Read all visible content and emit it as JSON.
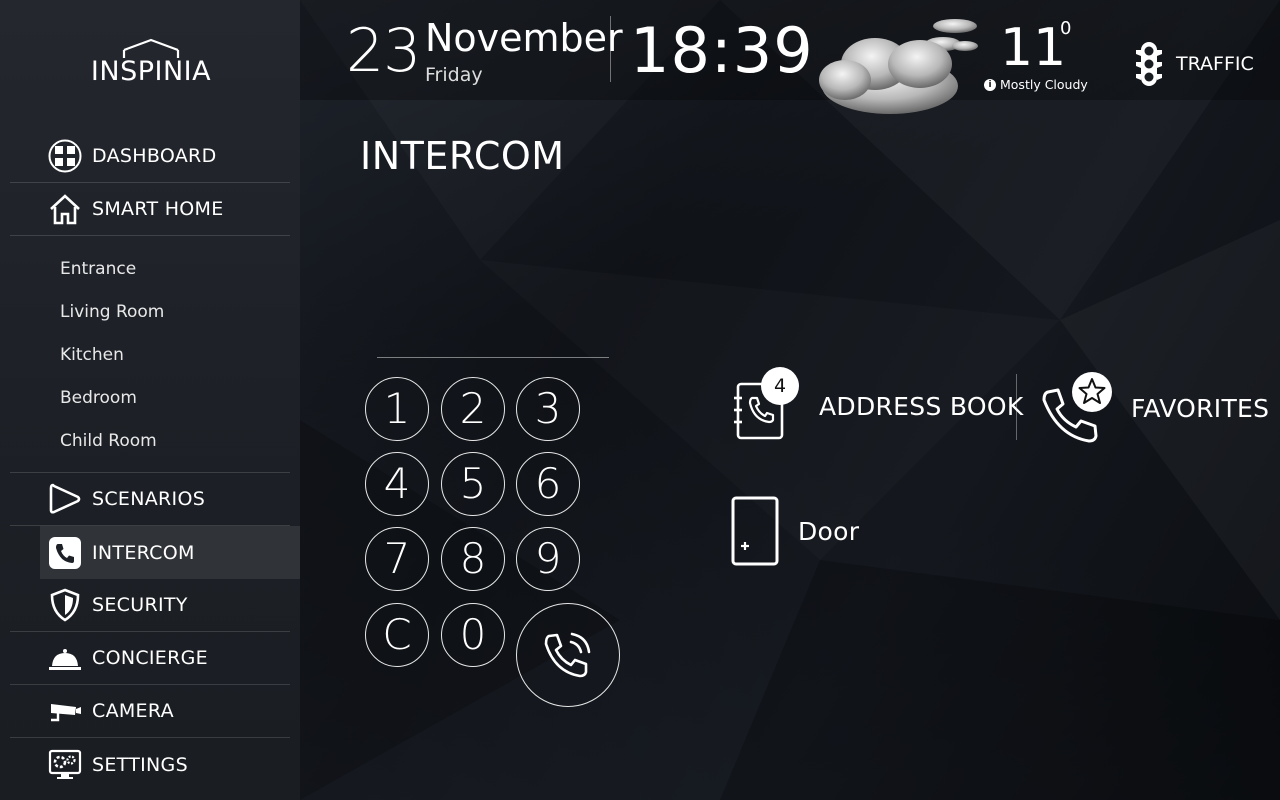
{
  "brand": {
    "logo_text": "INSPINIA"
  },
  "sidebar": {
    "items": [
      {
        "label": "DASHBOARD",
        "icon": "dashboard-icon"
      },
      {
        "label": "SMART HOME",
        "icon": "home-icon"
      },
      {
        "label": "SCENARIOS",
        "icon": "scenarios-icon"
      },
      {
        "label": "INTERCOM",
        "icon": "phone-icon",
        "active": true
      },
      {
        "label": "SECURITY",
        "icon": "shield-icon"
      },
      {
        "label": "CONCIERGE",
        "icon": "service-bell-icon"
      },
      {
        "label": "CAMERA",
        "icon": "camera-icon"
      },
      {
        "label": "SETTINGS",
        "icon": "settings-icon"
      }
    ],
    "rooms": [
      "Entrance",
      "Living Room",
      "Kitchen",
      "Bedroom",
      "Child Room"
    ]
  },
  "header": {
    "day": "23",
    "month": "November",
    "weekday": "Friday",
    "time": "18:39",
    "weather": {
      "temperature": "11",
      "unit": "0",
      "condition": "Mostly Cloudy",
      "icon": "cloud-icon"
    },
    "traffic_label": "TRAFFIC"
  },
  "main": {
    "title": "INTERCOM",
    "dial_value": "",
    "keypad": [
      "1",
      "2",
      "3",
      "4",
      "5",
      "6",
      "7",
      "8",
      "9",
      "C",
      "0"
    ],
    "address_book": {
      "label": "ADDRESS BOOK",
      "badge": "4"
    },
    "favorites": {
      "label": "FAVORITES"
    },
    "door": {
      "label": "Door"
    }
  },
  "colors": {
    "background": "#12151a",
    "sidebar": "#1f2329",
    "text": "#ffffff"
  }
}
